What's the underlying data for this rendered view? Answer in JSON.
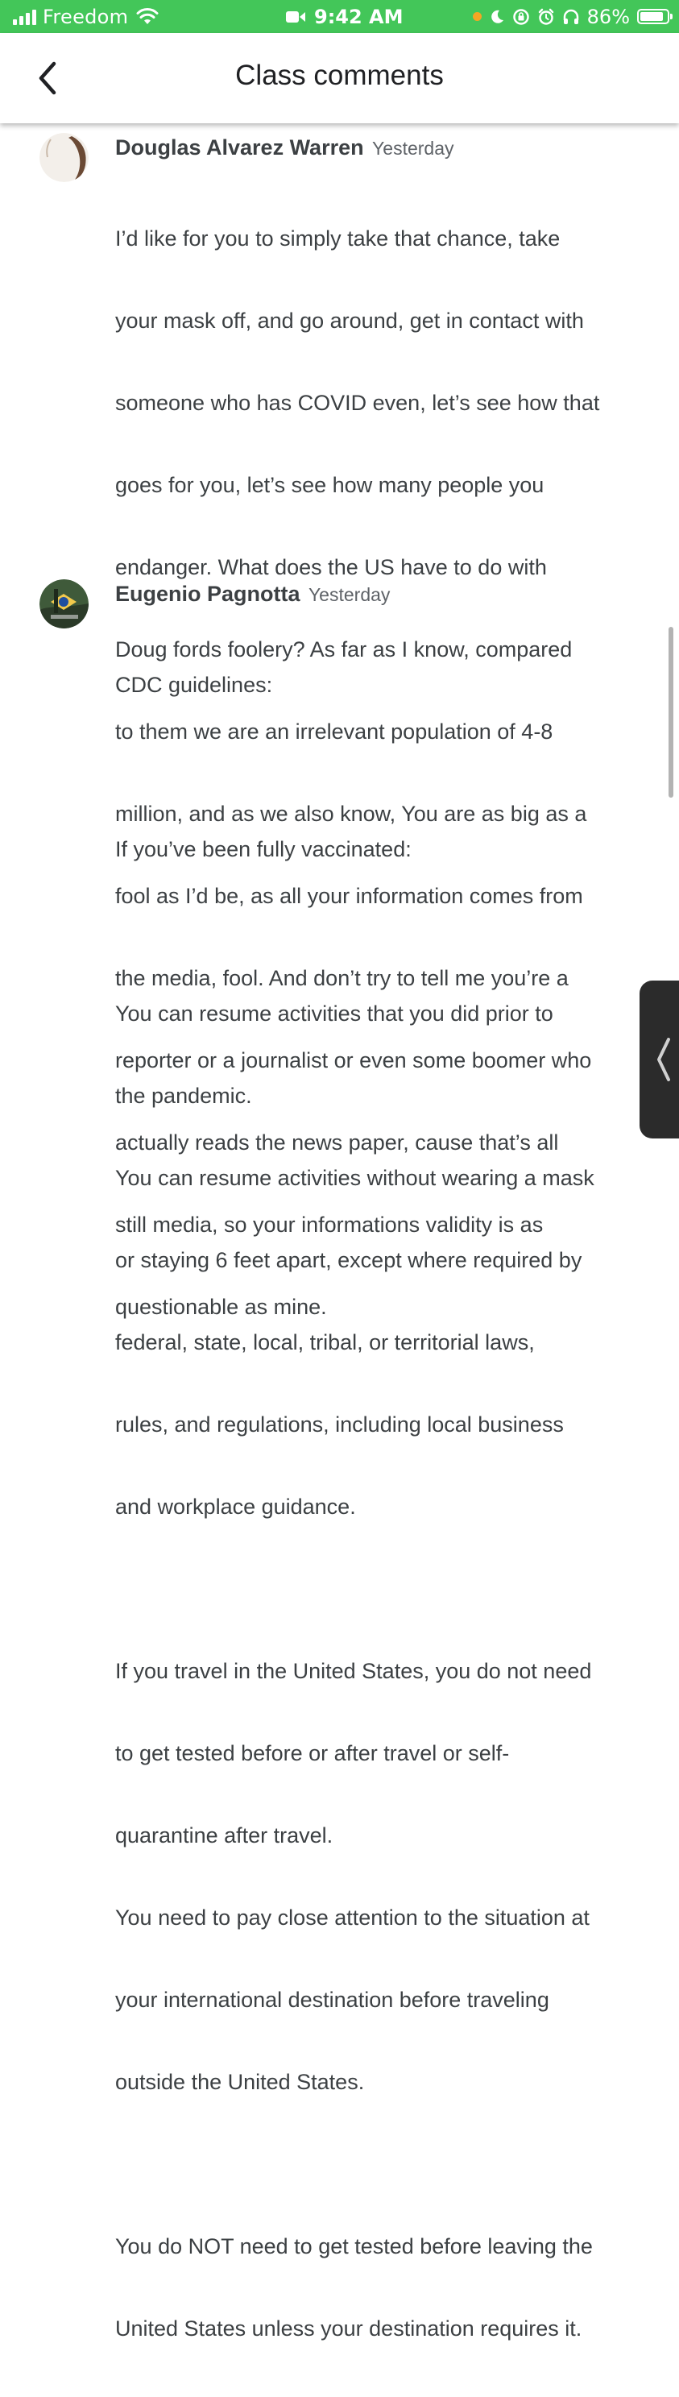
{
  "status_bar": {
    "carrier": "Freedom",
    "time": "9:42 AM",
    "battery_percent": "86%",
    "battery_level": 0.86,
    "colors": {
      "background": "#43c659"
    }
  },
  "header": {
    "title": "Class comments",
    "back_icon": "chevron-left-icon"
  },
  "comments": [
    {
      "author": "Douglas Alvarez Warren",
      "timestamp": "Yesterday",
      "avatar_icon": "user-avatar",
      "lines": [
        "I’d like for you to simply take that chance, take",
        "your mask off, and go around, get in contact with",
        "someone who has COVID even, let’s see how that",
        "goes for you, let’s see how many people you",
        "endanger. What does the US have to do with",
        "Doug fords foolery? As far as I know, compared",
        "to them we are an irrelevant population of 4-8",
        "million, and as we also know, You are as big as a",
        "fool as I’d be, as all your information comes from",
        "the media, fool. And don’t try to tell me you’re a",
        "reporter or a journalist or even some boomer who",
        "actually reads the news paper, cause that’s all",
        "still media, so your informations validity is as",
        "questionable as mine."
      ]
    },
    {
      "author": "Eugenio Pagnotta",
      "timestamp": "Yesterday",
      "avatar_icon": "user-avatar",
      "lines": [
        "CDC guidelines:",
        "",
        "If you’ve been fully vaccinated:",
        "",
        "You can resume activities that you did prior to",
        "the pandemic.",
        "You can resume activities without wearing a mask",
        "or staying 6 feet apart, except where required by",
        "federal, state, local, tribal, or territorial laws,",
        "rules, and regulations, including local business",
        "and workplace guidance.",
        "",
        "If you travel in the United States, you do not need",
        "to get tested before or after travel or self-",
        "quarantine after travel.",
        "You need to pay close attention to the situation at",
        "your international destination before traveling",
        "outside the United States.",
        "",
        "You do NOT need to get tested before leaving the",
        "United States unless your destination requires it."
      ]
    }
  ]
}
